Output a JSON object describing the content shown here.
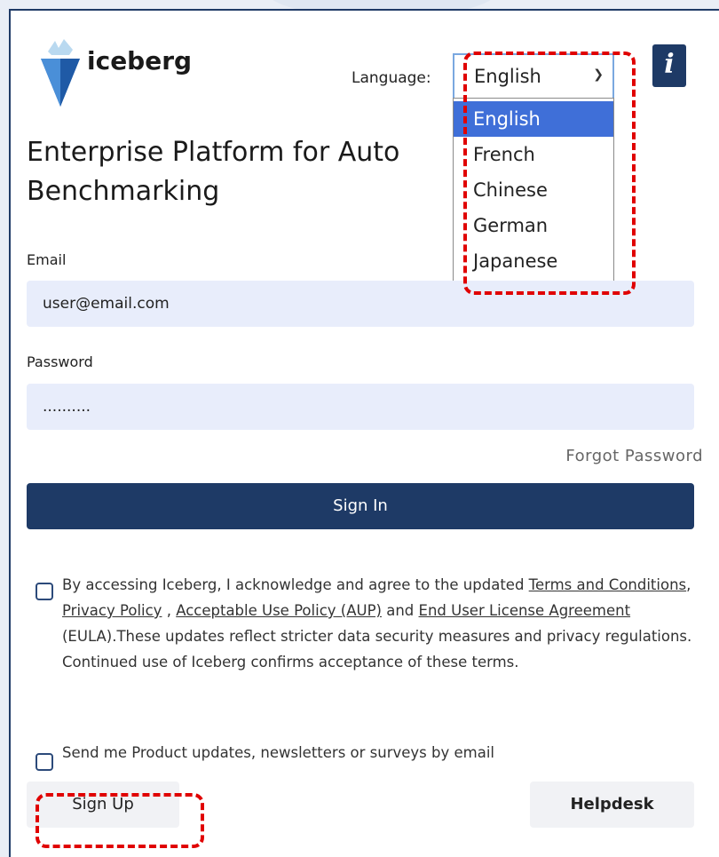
{
  "header": {
    "app_name": "iceberg",
    "language_label": "Language:",
    "language_selected": "English",
    "language_options": [
      "English",
      "French",
      "Chinese",
      "German",
      "Japanese"
    ],
    "info_label": "i"
  },
  "main": {
    "title_line1": "Enterprise Platform for Auto",
    "title_line2": "Benchmarking"
  },
  "form": {
    "email_label": "Email",
    "email_value": "user@email.com",
    "password_label": "Password",
    "password_value": "..........",
    "forgot_label": "Forgot Password",
    "signin_label": "Sign In"
  },
  "terms": {
    "t1": "By accessing Iceberg, I acknowledge and agree to the updated ",
    "link_terms": "Terms and Conditions",
    "t2": ", ",
    "link_privacy": "Privacy Policy",
    "t3": " , ",
    "link_aup": "Acceptable Use Policy (AUP)",
    "t4": " and ",
    "link_eula": "End User License Agreement",
    "t5": " (EULA).These updates reflect stricter data security measures and privacy regulations. Continued use of Iceberg confirms acceptance of these terms."
  },
  "updates": {
    "label": "Send me Product updates, newsletters or surveys by email"
  },
  "footer": {
    "signup_label": "Sign Up",
    "helpdesk_label": "Helpdesk"
  },
  "colors": {
    "primary": "#1e3a66",
    "selected_option": "#3f6fd8",
    "input_bg": "#e8edfb",
    "highlight": "#e00000"
  },
  "icons": [
    "iceberg-logo-icon",
    "chevron-down-icon",
    "info-icon"
  ]
}
